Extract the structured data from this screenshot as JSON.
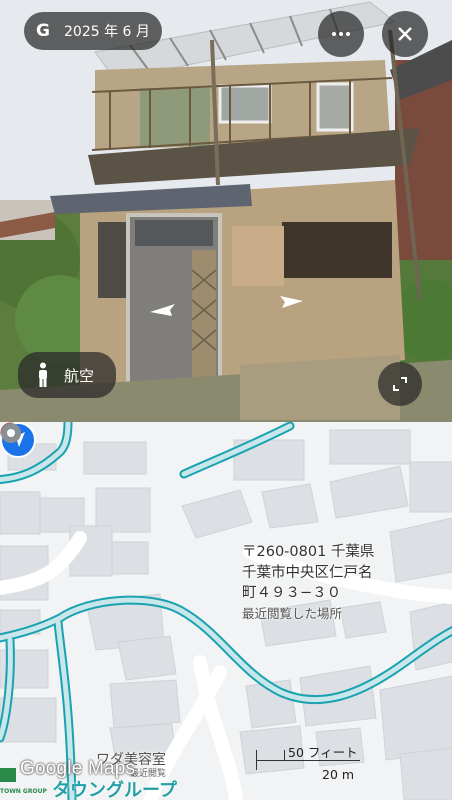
{
  "street_view": {
    "date_label": "2025 年 6 月",
    "google_glyph": "G",
    "more_label": "•••",
    "close_label": "✕",
    "aerial_label": "航空",
    "arrow_left": "navigation-arrow",
    "arrow_right": "navigation-arrow"
  },
  "map": {
    "address_line1": "〒260-0801 千葉県",
    "address_line2": "千葉市中央区仁戸名",
    "address_line3": "町４９３−３０",
    "recent_label": "最近閲覧した場所",
    "poi_name": "ワダ美容室",
    "poi_sub": "最近閲覧",
    "logo_text": "Google Maps",
    "overlay_text": "タウングループ",
    "town_small": "TOWN GROUP",
    "scale_imperial": "50 フィート",
    "scale_metric": "20 m",
    "colors": {
      "road_outline": "#19a2b0",
      "road_fill": "#c9e6ea",
      "pin": "#e94235",
      "location": "#1a73e8"
    }
  }
}
